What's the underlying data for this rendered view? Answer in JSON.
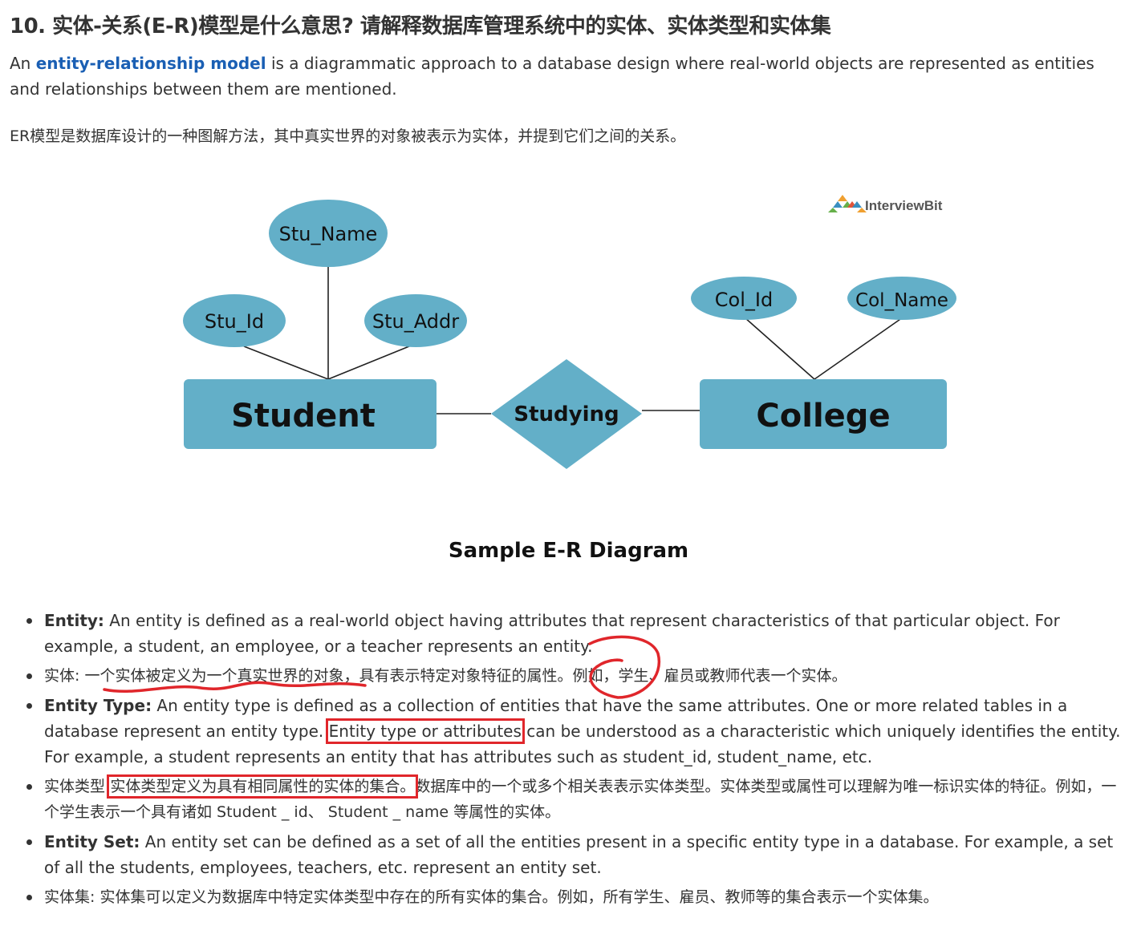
{
  "question": {
    "title": "10. 实体-关系(E-R)模型是什么意思? 请解释数据库管理系统中的实体、实体类型和实体集"
  },
  "intro": {
    "lead": "An ",
    "link_text": "entity-relationship model",
    "rest": " is a diagrammatic approach to a database design where real-world objects are represented as entities and relationships between them are mentioned.",
    "cn": "ER模型是数据库设计的一种图解方法，其中真实世界的对象被表示为实体，并提到它们之间的关系。"
  },
  "diagram": {
    "logo_text": "InterviewBit",
    "entities": [
      "Student",
      "College"
    ],
    "relationship": "Studying",
    "attributes": [
      "Stu_Name",
      "Stu_Id",
      "Stu_Addr",
      "Col_Id",
      "Col_Name"
    ],
    "caption": "Sample E-R Diagram",
    "shape_color": "#63afc8"
  },
  "definitions": [
    {
      "term": "Entity:",
      "text": " An entity is defined as a real-world object having attributes that represent characteristics of that particular object. For example, a student, an employee, or a teacher represents an entity."
    },
    {
      "term": "实体:",
      "text": " 一个实体被定义为一个真实世界的对象，具有表示特定对象特征的属性。例如，学生、雇员或教师代表一个实体。"
    },
    {
      "term": "Entity Type:",
      "text_a": " An entity type is defined as a collection of entities that have the same attributes. One or more related tables in a database represent an entity type.",
      "highlight": "Entity type or attributes",
      "text_b": " can be understood as a characteristic which uniquely identifies the entity.  For example, a student represents an entity that has attributes such as student_id, student_name, etc."
    },
    {
      "term": "实体类型:",
      "highlight": "实体类型定义为具有相同属性的实体的集合。",
      "text": "数据库中的一个或多个相关表表示实体类型。实体类型或属性可以理解为唯一标识实体的特征。例如，一个学生表示一个具有诸如 Student _ id、 Student _ name 等属性的实体。"
    },
    {
      "term": "Entity Set:",
      "text": " An entity set can be defined as a set of all the entities present in a specific entity type in a database. For example, a set of all the students, employees, teachers, etc. represent an entity set."
    },
    {
      "term": "实体集:",
      "text": " 实体集可以定义为数据库中特定实体类型中存在的所有实体的集合。例如，所有学生、雇员、教师等的集合表示一个实体集。"
    }
  ],
  "colors": {
    "link": "#1a5fb4",
    "annotation_red": "#e0262b",
    "text": "#333333"
  }
}
